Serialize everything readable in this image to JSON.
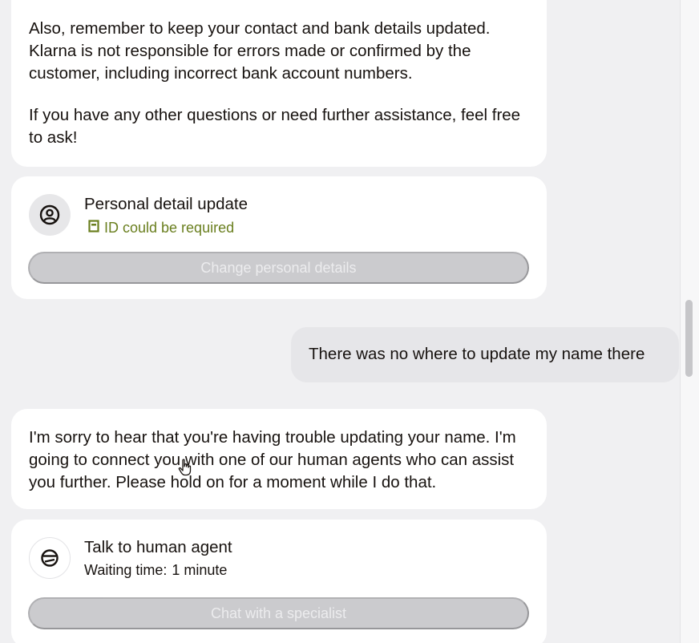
{
  "messages": {
    "assistant_1": {
      "paragraph_1": "Also, remember to keep your contact and bank details updated. Klarna is not responsible for errors made or confirmed by the customer, including incorrect bank account numbers.",
      "paragraph_2": "If you have any other questions or need further assistance, feel free to ask!"
    },
    "detail_card": {
      "icon": "user-circle-icon",
      "title": "Personal detail update",
      "note_icon": "id-document-icon",
      "note": "ID could be required",
      "button_label": "Change personal details"
    },
    "user_1": {
      "text": "There was no where to update my name there"
    },
    "assistant_2": {
      "text": "I'm sorry to hear that you're having trouble updating your name. I'm going to connect you with one of our human agents who can assist you further. Please hold on for a moment while I do that."
    },
    "agent_card": {
      "icon": "agent-icon",
      "title": "Talk to human agent",
      "waiting_label": "Waiting time:",
      "waiting_value": "1 minute",
      "button_label": "Chat with a specialist"
    }
  },
  "colors": {
    "background": "#f0f0f2",
    "card": "#ffffff",
    "user_bubble": "#e6e6e9",
    "note_green": "#6a7f1f",
    "disabled_button": "#cbcbce"
  }
}
